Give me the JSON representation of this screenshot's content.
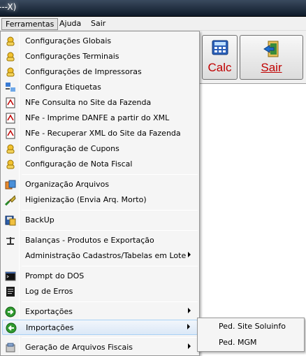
{
  "window": {
    "title": "---X)"
  },
  "menubar": [
    {
      "label": "Ferramentas"
    },
    {
      "label": "Ajuda"
    },
    {
      "label": "Sair"
    }
  ],
  "toolbar": {
    "calc_label": "Calc",
    "sair_label": "Sair",
    "calc_icon": "calculator-icon",
    "sair_icon": "exit-door-icon"
  },
  "menu": {
    "items": [
      {
        "label": "Configurações Globais",
        "icon": "settings-hand-icon"
      },
      {
        "label": "Configurações Terminais",
        "icon": "settings-hand-icon"
      },
      {
        "label": "Configurações de Impressoras",
        "icon": "settings-hand-icon"
      },
      {
        "label": "Configura Etiquetas",
        "icon": "labels-icon"
      },
      {
        "label": "NFe Consulta no Site da Fazenda",
        "icon": "pdf-document-icon"
      },
      {
        "label": "NFe - Imprime DANFE a partir do XML",
        "icon": "pdf-document-icon"
      },
      {
        "label": "NFe - Recuperar XML do Site da Fazenda",
        "icon": "pdf-document-icon"
      },
      {
        "label": "Configuração de Cupons",
        "icon": "settings-hand-icon"
      },
      {
        "label": "Configuração de Nota Fiscal",
        "icon": "settings-hand-icon"
      },
      {
        "label": "Organização Arquivos",
        "icon": "organize-files-icon"
      },
      {
        "label": "Higienização (Envia Arq. Morto)",
        "icon": "broom-icon"
      },
      {
        "label": "BackUp",
        "icon": "backup-icon"
      },
      {
        "label": "Balanças - Produtos e Exportação",
        "icon": "scale-icon"
      },
      {
        "label": "Administração Cadastros/Tabelas em Lote",
        "icon": ""
      },
      {
        "label": "Prompt do DOS",
        "icon": "dos-prompt-icon"
      },
      {
        "label": "Log de Erros",
        "icon": "log-icon"
      },
      {
        "label": "Exportações",
        "icon": "export-arrow-icon"
      },
      {
        "label": "Importações",
        "icon": "import-arrow-icon"
      },
      {
        "label": "Geração de Arquivos Fiscais",
        "icon": "fiscal-files-icon"
      }
    ]
  },
  "submenu": {
    "items": [
      {
        "label": "Ped. Site Soluinfo"
      },
      {
        "label": "Ped. MGM"
      }
    ]
  }
}
